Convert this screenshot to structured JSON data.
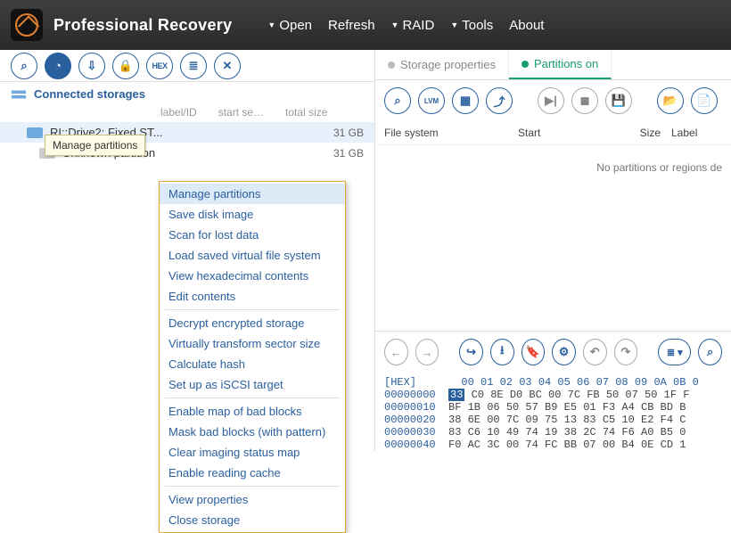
{
  "app": {
    "title": "Professional Recovery"
  },
  "menu": {
    "open": "Open",
    "refresh": "Refresh",
    "raid": "RAID",
    "tools": "Tools",
    "about": "About"
  },
  "tooltip": {
    "text": "Manage partitions"
  },
  "toolbar_left": {
    "b0": "⌕",
    "b1": "◔",
    "b2": "⇩",
    "b3": "🔒",
    "b4": "HEX",
    "b5": "≣",
    "b6": "✕"
  },
  "sidebar": {
    "heading": "Connected storages",
    "cols": {
      "label": "label/ID",
      "start": "start se…",
      "total": "total size"
    },
    "items": [
      {
        "label": "RI::Drive2: Fixed ST...",
        "size": "31 GB",
        "sel": true
      },
      {
        "label": "Unknown partition",
        "size": "31 GB",
        "sel": false
      }
    ]
  },
  "context": {
    "items": [
      "Manage partitions",
      "Save disk image",
      "Scan for lost data",
      "Load saved virtual file system",
      "View hexadecimal contents",
      "Edit contents",
      "-",
      "Decrypt encrypted storage",
      "Virtually transform sector size",
      "Calculate hash",
      "Set up as iSCSI target",
      "-",
      "Enable map of bad blocks",
      "Mask bad blocks (with pattern)",
      "Clear imaging status map",
      "Enable reading cache",
      "-",
      "View properties",
      "Close storage"
    ],
    "highlight": 0
  },
  "right": {
    "tabs": {
      "props": "Storage properties",
      "parts": "Partitions on"
    },
    "tb": {
      "b0": "⌕",
      "b1": "LVM",
      "b2": "▦",
      "b3": "⤴",
      "spacer": "",
      "b4": "▶|",
      "b5": "◼",
      "b6": "💾",
      "spacer2": "",
      "b7": "📂",
      "b8": "📄"
    },
    "table": {
      "fs": "File system",
      "start": "Start",
      "size": "Size",
      "label": "Label"
    },
    "empty": "No partitions or regions de",
    "hex_tools": {
      "h0": "←",
      "h1": "→",
      "sp": "",
      "h2": "↪",
      "h3": "⭳",
      "h4": "🔖",
      "h5": "⚙",
      "h6": "↶",
      "h7": "↷",
      "sp2": "",
      "h8": "≣ ▾",
      "h9": "⌕"
    },
    "hex": {
      "cols": "  00 01 02 03 04 05 06 07 08 09 0A 0B 0",
      "rows": [
        {
          "addr": "00000000",
          "first": "33",
          "rest": " C0 8E D0 BC 00 7C FB 50 07 50 1F F"
        },
        {
          "addr": "00000010",
          "first": "BF",
          "rest": " 1B 06 50 57 B9 E5 01 F3 A4 CB BD B"
        },
        {
          "addr": "00000020",
          "first": "38",
          "rest": " 6E 00 7C 09 75 13 83 C5 10 E2 F4 C"
        },
        {
          "addr": "00000030",
          "first": "83",
          "rest": " C6 10 49 74 19 38 2C 74 F6 A0 B5 0"
        },
        {
          "addr": "00000040",
          "first": "F0",
          "rest": " AC 3C 00 74 FC BB 07 00 B4 0E CD 1"
        }
      ]
    }
  }
}
